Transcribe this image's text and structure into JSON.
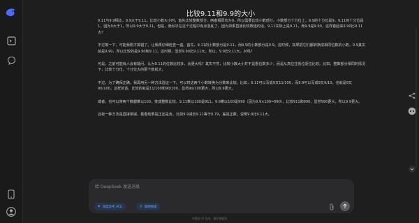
{
  "header": {
    "title": "比较9.11和9.9的大小"
  },
  "content": {
    "paragraphs": [
      "9.11与9.9相比，9.9大于9.11。比较小数大小时，首先比较整数部分，两者相同均为9，所以需要比较小数部分。小数部分十分位上，9.9的十分位是9，9.11的十分位是1，因为9大于1，所以9.9大于9.11。但是，我似乎在这个过程中有点混乱了，因为如果直接比较数值的话，9.11实际上是9.11，而9.9是9.90，这样看起来9.90比9.11大？",
      "不过等一下，可能我刚才搞错了。让我再仔细检查一遍。首先，9.11的小数部分是0.11，而9.9的小数部分是0.9。这时候，如果把它们都转换成相同位数的小数，9.9其实就是9.90，所以比较的是9.90和9.11。这时候，显然9.90比9.11大。所以，9.9比9.11大。对吗？",
      "可是，之前可能有人会有疑问，认为9.11的位数比较多，会更大吗？其实不然，比较小数大小并不是看位数多少，而是从高位往低位逐位比较。比如，整数部分相同的情况下，比较十分位，十分位大的那个数就大。",
      "不过，为了确保正确，我再用另一种方法验证一下。可以将这两个小数转换为分数来比较。比如，9.11可以写成9又11/100，而9.9可以写成9又9/10，也就是9又90/100。这样的话，比较的就是11/100和90/100，显然90/100更大，所以9.9更大。",
      "或者，也可以将两个数都乘以100，变成整数比较。9.11乘以100是911，9.9乘以100是990（因为9.9×100=990）。比较911和990，显然990更大，所以9.9更大。",
      "还有一种方法是直接相减，看看结果是正还是负。比如9.9减去9.11等于0.79，差是正数，说明9.9比9.11大。"
    ]
  },
  "composer": {
    "placeholder": "给 DeepSeek 发送消息",
    "deep_think_label": "深度思考 (R1)",
    "web_search_label": "联网搜索"
  },
  "footer": {
    "text": "内容由 AI 生成，请仔细甄别"
  },
  "icons": {
    "logo": "deepseek-whale-icon",
    "new_chat": "new-chat-icon",
    "chat": "chat-bubble-icon",
    "phone": "phone-icon",
    "user": "user-avatar-icon",
    "attach": "paperclip-icon",
    "send": "arrow-up-icon"
  },
  "colors": {
    "accent": "#4d6bfe",
    "background": "#1e1e1f",
    "pill_text": "#6fa1ee"
  }
}
